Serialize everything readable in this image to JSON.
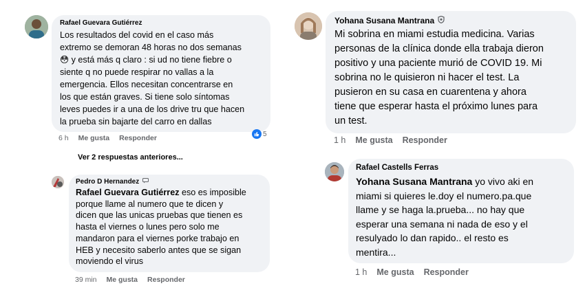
{
  "comments": [
    {
      "author": "Rafael Guevara Gutiérrez",
      "lines": [
        "Los resultados del covid en el caso más",
        "extremo se demoran 48 horas no dos semanas",
        "😳 y está más q claro : si ud no tiene fiebre o",
        "siente q no puede respirar no vallas a la",
        "emergencia. Ellos necesitan concentrarse en",
        "los que están graves. Si tiene solo síntomas",
        "leves puedes ir a una de los drive tru que hacen",
        "la prueba sin bajarte del carro en dallas"
      ],
      "time": "6 h",
      "like_label": "Me gusta",
      "reply_label": "Responder",
      "reaction_count": "5"
    },
    {
      "author": "Pedro D Hernandez",
      "mention": "Rafael Guevara Gutiérrez",
      "first_line_rest": " eso es imposible",
      "lines": [
        "porque llame al numero que te dicen y",
        "dicen que las unicas pruebas que tienen es",
        "hasta el viernes o lunes pero solo me",
        "mandaron para el viernes porke trabajo en",
        "HEB y necesito saberlo antes que se sigan",
        "moviendo el virus"
      ],
      "time": "39 min",
      "like_label": "Me gusta",
      "reply_label": "Responder"
    },
    {
      "author": "Yohana Susana Mantrana",
      "lines": [
        "Mi sobrina en miami estudia medicina.  Varias",
        "personas de la clínica donde ella trabaja dieron",
        "positivo y una paciente murió de COVID 19. Mi",
        "sobrina no le quisieron ni hacer el test. La",
        "pusieron en su casa en cuarentena y ahora",
        "tiene que esperar hasta el próximo lunes para",
        "un test."
      ],
      "time": "1 h",
      "like_label": "Me gusta",
      "reply_label": "Responder"
    },
    {
      "author": "Rafael Castells Ferras",
      "mention": "Yohana Susana Mantrana",
      "first_line_rest": " yo vivo aki en",
      "lines": [
        "miami si quieres le.doy el numero.pa.que",
        "llame y se haga la.prueba... no hay que",
        "esperar una semana ni nada de eso y el",
        "resulyado lo dan rapido.. el resto es",
        "mentira..."
      ],
      "time": "1 h",
      "like_label": "Me gusta",
      "reply_label": "Responder"
    }
  ],
  "more_replies": "Ver 2 respuestas anteriores...",
  "colors": {
    "bubble": "#f0f2f5",
    "meta": "#65676b",
    "like_blue": "#1877f2"
  }
}
